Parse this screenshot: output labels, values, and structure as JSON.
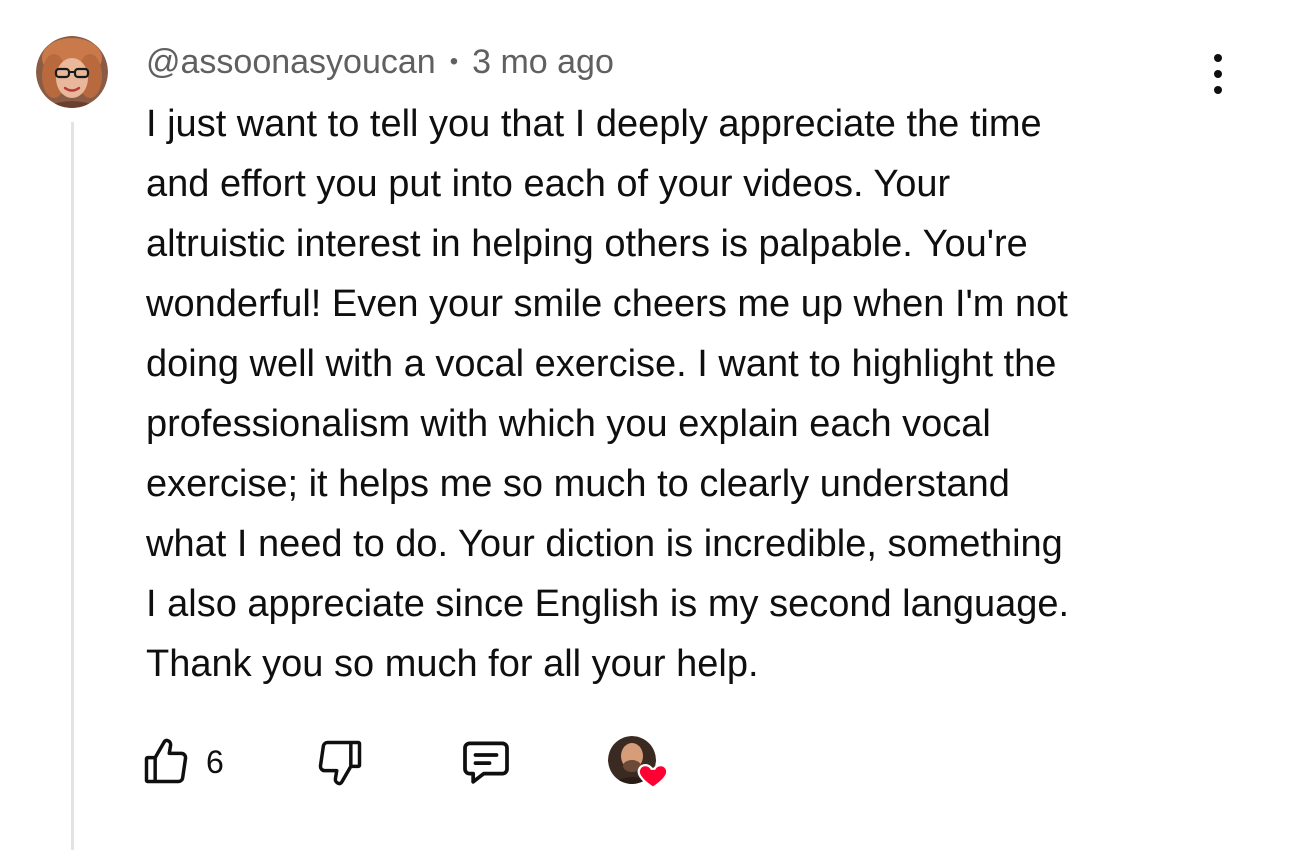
{
  "comment": {
    "author": "@assoonasyoucan",
    "separator": "•",
    "time": "3 mo ago",
    "body_lines": [
      "I just want to tell you that I deeply appreciate the time",
      "and effort you put into each of your videos. Your",
      "altruistic interest in helping others is palpable. You're",
      "wonderful! Even your smile cheers me up when I'm not",
      "doing well with a vocal exercise. I want to highlight the",
      "professionalism with which you explain each vocal",
      "exercise; it helps me so much to clearly understand",
      "what I need to do. Your diction is incredible, something",
      "I also appreciate since English is my second language.",
      "Thank you so much for all your help."
    ],
    "like_count": "6"
  },
  "icons": {
    "more": "vertical-ellipsis-icon",
    "like": "thumbs-up-icon",
    "dislike": "thumbs-down-icon",
    "reply": "comment-bubble-icon",
    "creator_heart": "heart-icon"
  },
  "colors": {
    "text": "#0f0f0f",
    "meta": "#606060",
    "thread_line": "#e3e3e3",
    "heart": "#ff0033"
  }
}
